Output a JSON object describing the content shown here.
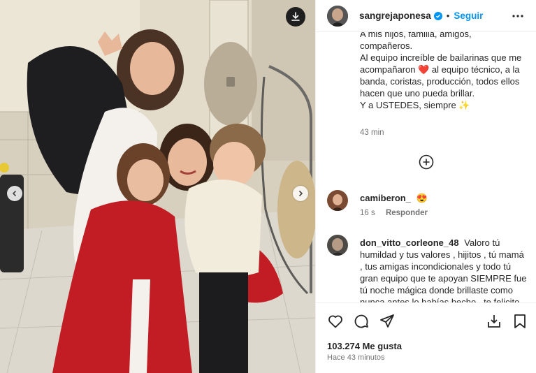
{
  "post": {
    "username": "sangrejaponesa",
    "follow_label": "Seguir",
    "separator": "•",
    "caption": "A mis hijos, familia, amigos,\ncompañeros.\nAl equipo increíble de bailarinas que me acompañaron ❤️ al equipo técnico, a la banda, coristas, producción, todos ellos hacen que uno pueda brillar.\nY a USTEDES, siempre ✨",
    "caption_time": "43 min",
    "likes": "103.274 Me gusta",
    "posted": "Hace 43 minutos"
  },
  "comments": [
    {
      "username": "camiberon_",
      "text": "😍",
      "time": "16 s",
      "reply_label": "Responder"
    },
    {
      "username": "don_vitto_corleone_48",
      "text": "Valoro tú humildad y tus valores , hijitos , tú mamá , tus amigas incondicionales y todo tú gran equipo que te apoyan SIEMPRE fue tú noche mágica donde brillaste como nunca antes lo habías hecho , te felicito"
    }
  ],
  "icons": {
    "download": "download-icon",
    "prev": "chevron-left-icon",
    "next": "chevron-right-icon",
    "verified": "verified-badge-icon",
    "more": "more-horizontal-icon",
    "load_more": "plus-circle-icon",
    "like": "heart-icon",
    "comment": "comment-icon",
    "share": "paper-plane-icon",
    "save_to": "save-to-collection-icon",
    "bookmark": "bookmark-icon"
  },
  "colors": {
    "accent": "#0095f6",
    "text": "#262626",
    "muted": "#737373",
    "divider": "#efefef"
  }
}
